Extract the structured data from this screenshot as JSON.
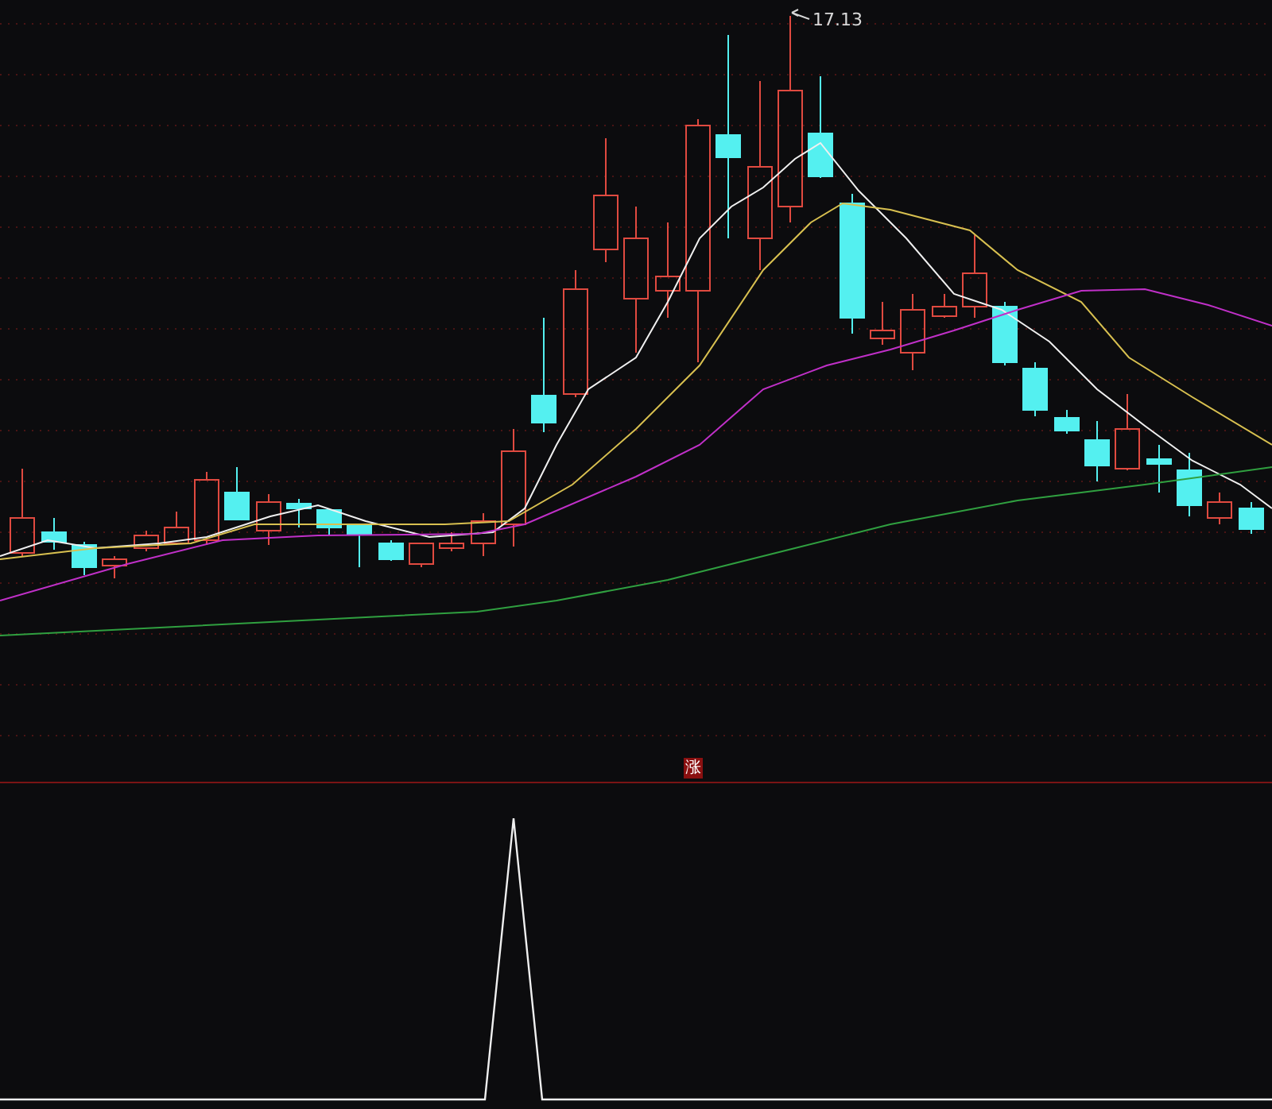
{
  "main_chart": {
    "high_label": "17.13"
  },
  "signal_marker": {
    "label": "涨"
  }
}
